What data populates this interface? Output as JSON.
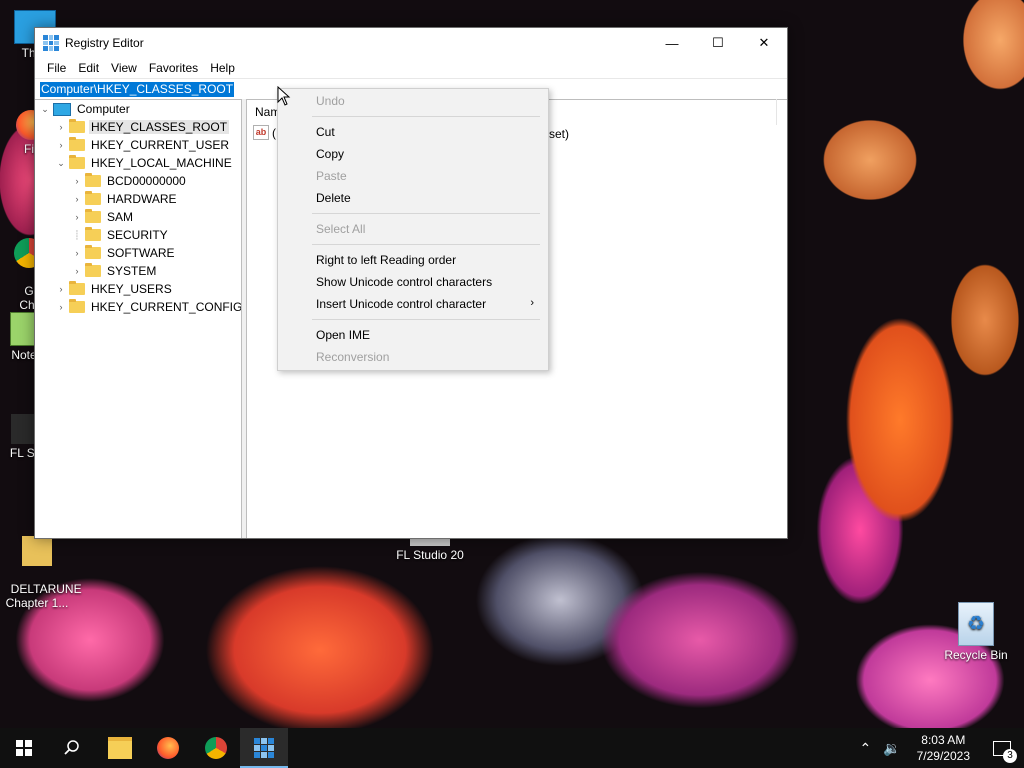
{
  "window": {
    "title": "Registry Editor",
    "controls": {
      "minimize": "—",
      "maximize": "☐",
      "close": "✕"
    }
  },
  "menu": [
    "File",
    "Edit",
    "View",
    "Favorites",
    "Help"
  ],
  "address": "Computer\\HKEY_CLASSES_ROOT",
  "tree": {
    "root": "Computer",
    "nodes": [
      {
        "label": "HKEY_CLASSES_ROOT",
        "selected": true
      },
      {
        "label": "HKEY_CURRENT_USER"
      },
      {
        "label": "HKEY_LOCAL_MACHINE",
        "expanded": true
      },
      {
        "label": "BCD00000000"
      },
      {
        "label": "HARDWARE"
      },
      {
        "label": "SAM"
      },
      {
        "label": "SECURITY"
      },
      {
        "label": "SOFTWARE"
      },
      {
        "label": "SYSTEM"
      },
      {
        "label": "HKEY_USERS"
      },
      {
        "label": "HKEY_CURRENT_CONFIG"
      }
    ]
  },
  "list": {
    "column_name": "Nam",
    "row_name": "(D",
    "row_data": "set)"
  },
  "context_menu": {
    "undo": "Undo",
    "cut": "Cut",
    "copy": "Copy",
    "paste": "Paste",
    "delete": "Delete",
    "select_all": "Select All",
    "rtl": "Right to left Reading order",
    "show_unicode": "Show Unicode control characters",
    "insert_unicode": "Insert Unicode control character",
    "open_ime": "Open IME",
    "reconversion": "Reconversion"
  },
  "desktop": {
    "icons": [
      "Thi",
      "Fir",
      "Go\nChr",
      "Note",
      "FL St",
      "DELTARUNE\nChapter 1...",
      "FL Studio 20",
      "Recycle Bin"
    ]
  },
  "taskbar": {
    "time": "8:03 AM",
    "date": "7/29/2023",
    "notifications": "3"
  },
  "colors": {
    "selection": "#0078d7",
    "taskbar": "#101010",
    "folder": "#f6cf57"
  }
}
